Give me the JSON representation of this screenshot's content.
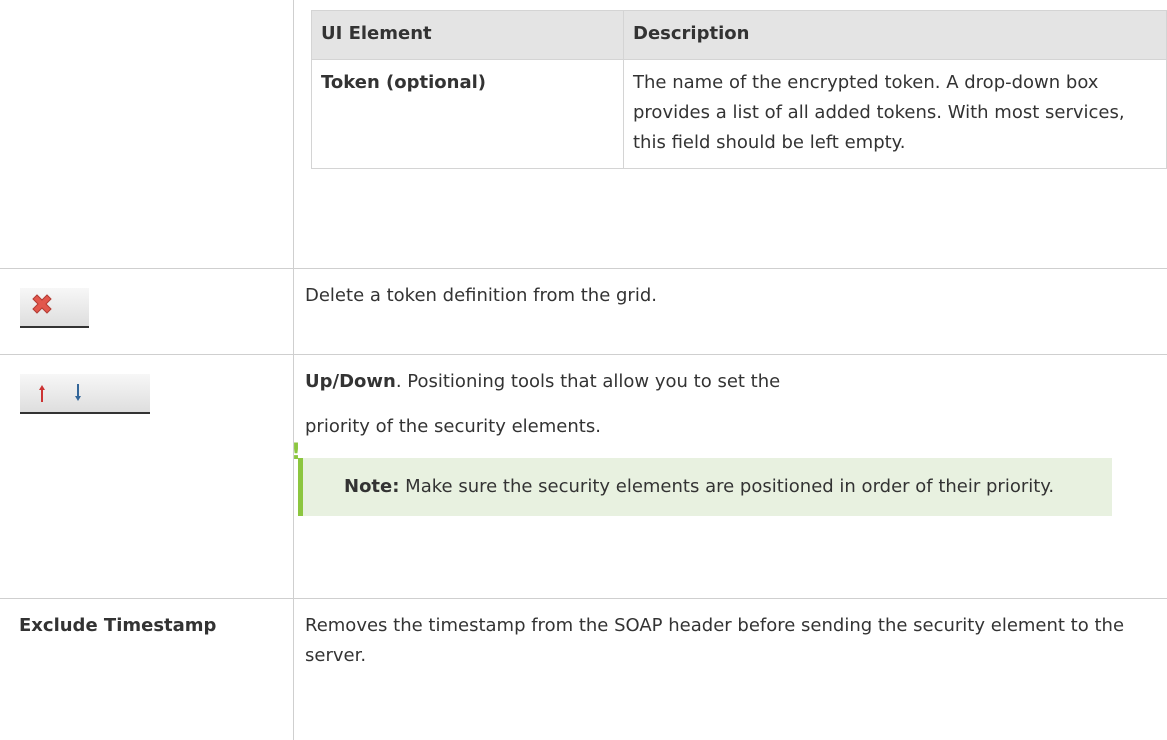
{
  "inner_table": {
    "headers": [
      "UI Element",
      "Description"
    ],
    "rows": [
      {
        "element": "Token (optional)",
        "description": "The name of the encrypted token. A drop-down box provides a list of all added tokens. With most services, this field should be left empty."
      }
    ]
  },
  "rows": {
    "delete": {
      "icon": "delete-x-icon",
      "description": "Delete a token definition from the grid."
    },
    "updown": {
      "icons": [
        "up-arrow-icon",
        "down-arrow-icon"
      ],
      "title": "Up/Down",
      "line1": ". Positioning tools that allow you to set the",
      "line2": "priority of the security elements.",
      "note_label": "Note:",
      "note_text": " Make sure the security elements are positioned in order of their priority."
    },
    "exclude": {
      "label": "Exclude Timestamp",
      "description": "Removes the timestamp from the SOAP header before sending the security element to the server."
    }
  },
  "colors": {
    "note_accent": "#8cc63f",
    "note_bg": "#e8f1e0",
    "delete_icon": "#e2574c",
    "up_arrow": "#cc3333",
    "down_arrow": "#336699"
  }
}
